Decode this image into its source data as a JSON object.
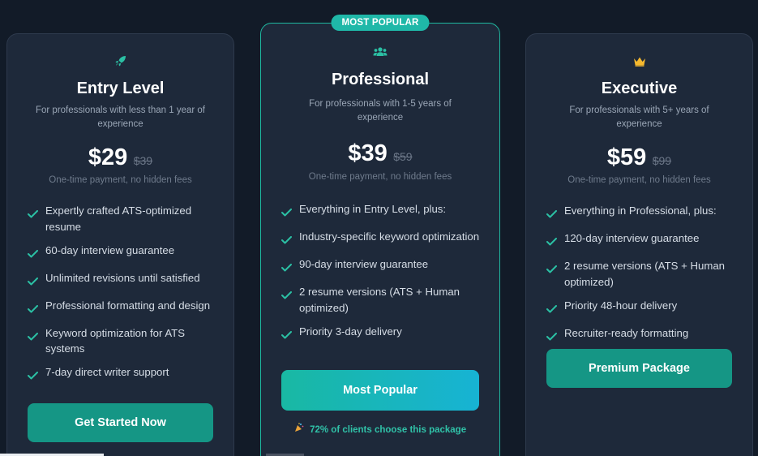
{
  "plans": [
    {
      "icon": "rocket-icon",
      "title": "Entry Level",
      "description": "For professionals with less than 1 year of experience",
      "price": "$29",
      "old_price": "$39",
      "price_note": "One-time payment, no hidden fees",
      "features": [
        "Expertly crafted ATS-optimized resume",
        "60-day interview guarantee",
        "Unlimited revisions until satisfied",
        "Professional formatting and design",
        "Keyword optimization for ATS systems",
        "7-day direct writer support"
      ],
      "button_label": "Get Started Now"
    },
    {
      "badge": "MOST POPULAR",
      "icon": "users-icon",
      "title": "Professional",
      "description": "For professionals with 1-5 years of experience",
      "price": "$39",
      "old_price": "$59",
      "price_note": "One-time payment, no hidden fees",
      "features": [
        "Everything in Entry Level, plus:",
        "Industry-specific keyword optimization",
        "90-day interview guarantee",
        "2 resume versions (ATS + Human optimized)",
        "Priority 3-day delivery"
      ],
      "button_label": "Most Popular",
      "client_note": "72% of clients choose this package",
      "client_note_icon": "party-popper-icon"
    },
    {
      "icon": "crown-icon",
      "title": "Executive",
      "description": "For professionals with 5+ years of experience",
      "price": "$59",
      "old_price": "$99",
      "price_note": "One-time payment, no hidden fees",
      "features": [
        "Everything in Professional, plus:",
        "120-day interview guarantee",
        "2 resume versions (ATS + Human optimized)",
        "Priority 48-hour delivery",
        "Recruiter-ready formatting"
      ],
      "button_label": "Premium Package"
    }
  ],
  "colors": {
    "accent": "#1fb8a8",
    "check": "#2bc0a4",
    "crown": "#f5b82e",
    "background": "#121b28",
    "card": "#1e293a"
  }
}
